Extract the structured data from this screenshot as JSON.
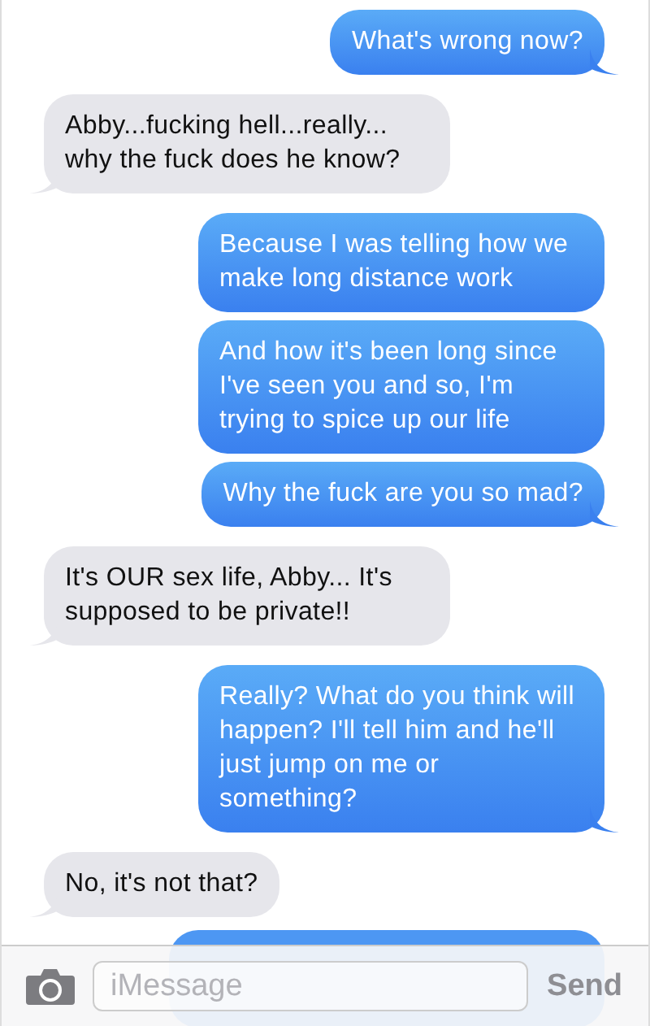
{
  "messages": [
    {
      "kind": "sent",
      "text": "What's wrong now?",
      "tail": true
    },
    {
      "kind": "received",
      "text": "Abby...fucking hell...really... why the fuck does he know?",
      "tail": true
    },
    {
      "kind": "sent",
      "text": "Because I was telling how we make long distance work",
      "tail": false
    },
    {
      "kind": "sent",
      "text": "And how it's been long since I've seen you and so, I'm trying to spice up our life",
      "tail": false
    },
    {
      "kind": "sent",
      "text": "Why the fuck are you so mad?",
      "tail": true
    },
    {
      "kind": "received",
      "text": "It's OUR sex life, Abby... It's supposed to be private!!",
      "tail": true
    },
    {
      "kind": "sent",
      "text": "Really? What do you think will happen? I'll tell him and he'll just jump on me or something?",
      "tail": true
    },
    {
      "kind": "received",
      "text": "No, it's not that?",
      "tail": true
    }
  ],
  "composer": {
    "placeholder": "iMessage",
    "send": "Send"
  }
}
